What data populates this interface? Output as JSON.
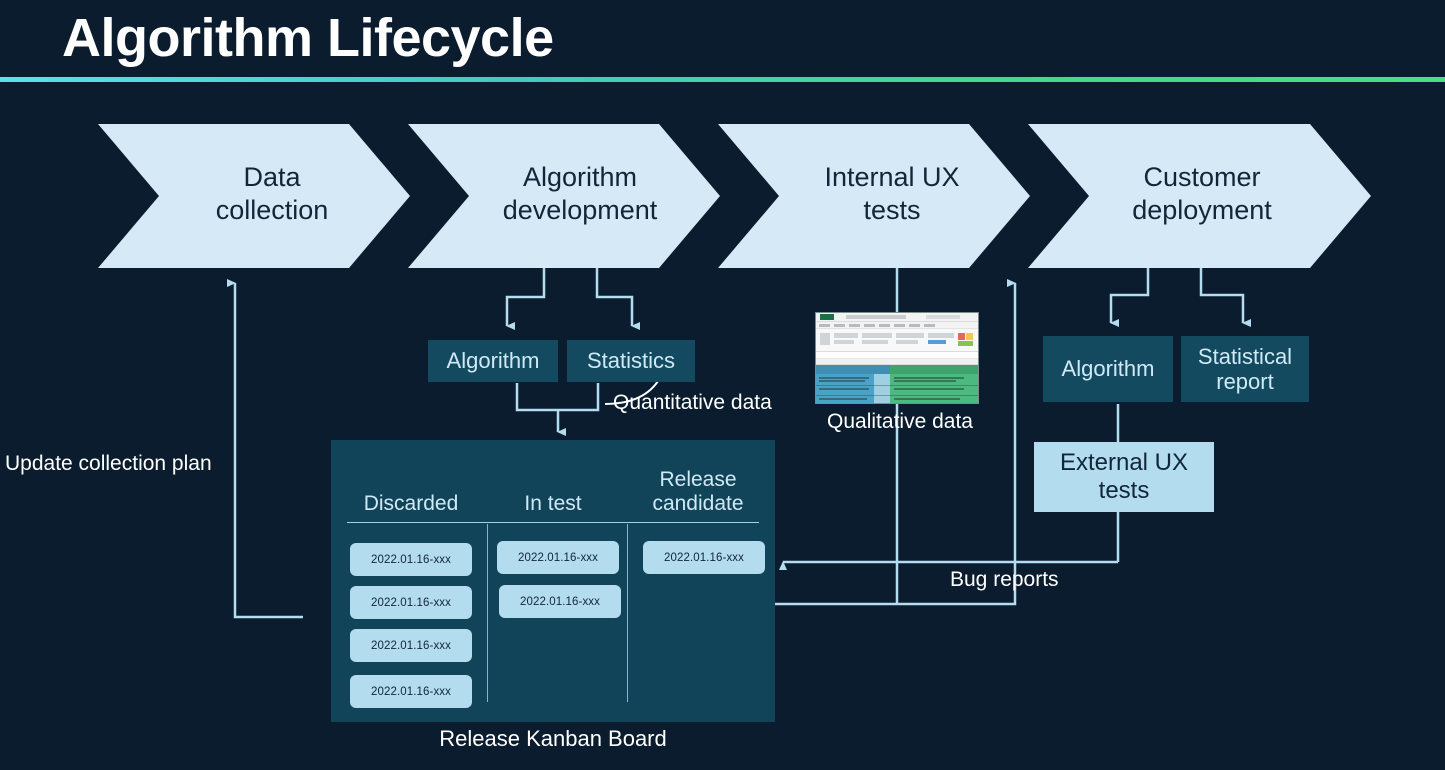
{
  "header": {
    "title": "Algorithm Lifecycle",
    "accent_from": "#5ce1e6",
    "accent_to": "#4ade80"
  },
  "theme": {
    "background": "#0a1c2e",
    "chevron_fill": "#d5eaf6",
    "chevron_text": "#12263a",
    "teal_box": "#144a60",
    "light_box": "#b3dcee",
    "kanban_bg": "#124459",
    "connector": "#b3dcee"
  },
  "pipeline": {
    "stages": [
      {
        "line1": "Data",
        "line2": "collection"
      },
      {
        "line1": "Algorithm",
        "line2": "development"
      },
      {
        "line1": "Internal UX",
        "line2": "tests"
      },
      {
        "line1": "Customer",
        "line2": "deployment"
      }
    ]
  },
  "dev_outputs": {
    "algorithm": "Algorithm",
    "statistics": "Statistics",
    "quantitative_label": "Quantitative data"
  },
  "qualitative": {
    "caption": "Qualitative data"
  },
  "deployment_outputs": {
    "algorithm": "Algorithm",
    "statistical_report_line1": "Statistical",
    "statistical_report_line2": "report",
    "external_ux_line1": "External UX",
    "external_ux_line2": "tests"
  },
  "kanban": {
    "caption": "Release Kanban Board",
    "columns": [
      {
        "title_line1": "Discarded",
        "title_line2": "",
        "cards": [
          "2022.01.16-xxx",
          "2022.01.16-xxx",
          "2022.01.16-xxx",
          "2022.01.16-xxx"
        ]
      },
      {
        "title_line1": "In test",
        "title_line2": "",
        "cards": [
          "2022.01.16-xxx",
          "2022.01.16-xxx"
        ]
      },
      {
        "title_line1": "Release",
        "title_line2": "candidate",
        "cards": [
          "2022.01.16-xxx"
        ]
      }
    ]
  },
  "flows": {
    "update_collection_plan": "Update collection plan",
    "bug_reports": "Bug reports"
  }
}
